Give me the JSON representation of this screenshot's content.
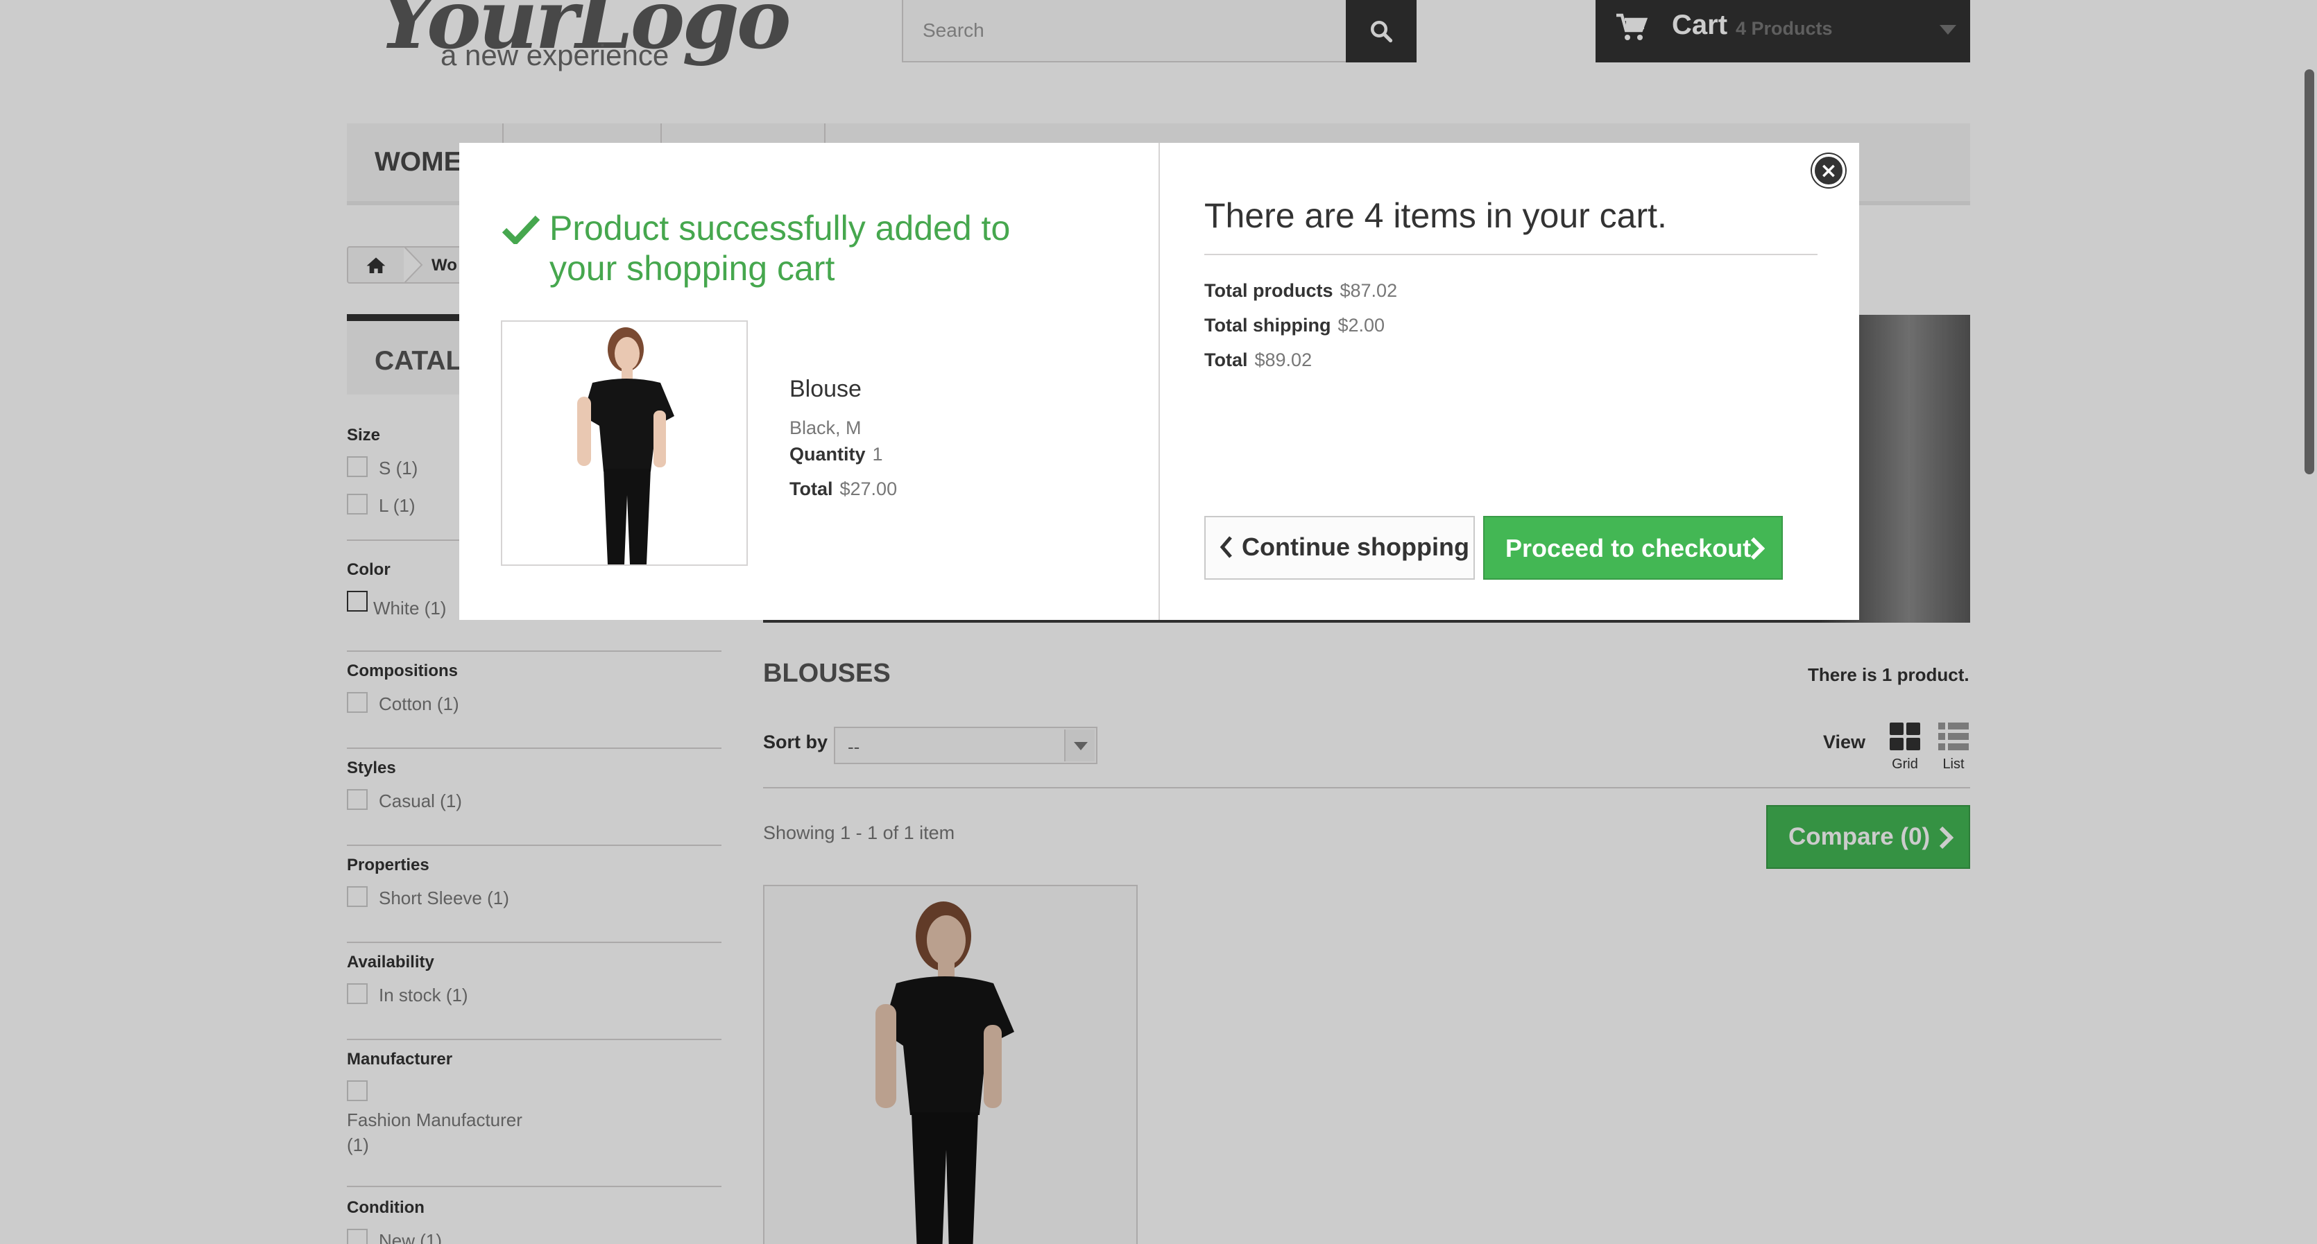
{
  "header": {
    "logo_main": "YourLogo",
    "logo_sub": "a new experience",
    "search_placeholder": "Search",
    "cart_label": "Cart",
    "cart_count": "4 Products"
  },
  "nav": {
    "items": [
      {
        "label": "WOMEN"
      },
      {
        "label": ""
      },
      {
        "label": ""
      }
    ]
  },
  "breadcrumb": {
    "current": "Wo"
  },
  "sidebar": {
    "catalog_title": "CATALO",
    "filters": [
      {
        "title": "Size",
        "items": [
          "S (1)",
          "L (1)"
        ]
      },
      {
        "title": "Color",
        "items": [
          "White (1)"
        ]
      },
      {
        "title": "Compositions",
        "items": [
          "Cotton (1)"
        ]
      },
      {
        "title": "Styles",
        "items": [
          "Casual (1)"
        ]
      },
      {
        "title": "Properties",
        "items": [
          "Short Sleeve (1)"
        ]
      },
      {
        "title": "Availability",
        "items": [
          "In stock (1)"
        ]
      },
      {
        "title": "Manufacturer",
        "items": [
          "Fashion Manufacturer",
          "(1)"
        ]
      },
      {
        "title": "Condition",
        "items": [
          "New (1)"
        ]
      }
    ]
  },
  "category": {
    "title": "BLOUSES",
    "product_count": "There is 1 product.",
    "sort_label": "Sort by",
    "sort_value": "--",
    "view_label": "View",
    "view_grid": "Grid",
    "view_list": "List",
    "showing": "Showing 1 - 1 of 1 item",
    "compare": "Compare (0)"
  },
  "modal": {
    "success_line1": "Product successfully added to",
    "success_line2": "your shopping cart",
    "product_name": "Blouse",
    "product_attributes": "Black, M",
    "quantity_label": "Quantity",
    "quantity_value": "1",
    "total_label": "Total",
    "total_value": "$27.00",
    "cart_message": "There are 4 items in your cart.",
    "total_products_label": "Total products",
    "total_products_value": "$87.02",
    "total_shipping_label": "Total shipping",
    "total_shipping_value": "$2.00",
    "grand_total_label": "Total",
    "grand_total_value": "$89.02",
    "continue_label": "Continue shopping",
    "checkout_label": "Proceed to checkout"
  },
  "colors": {
    "accent_green": "#46a74e",
    "dark": "#333333"
  }
}
